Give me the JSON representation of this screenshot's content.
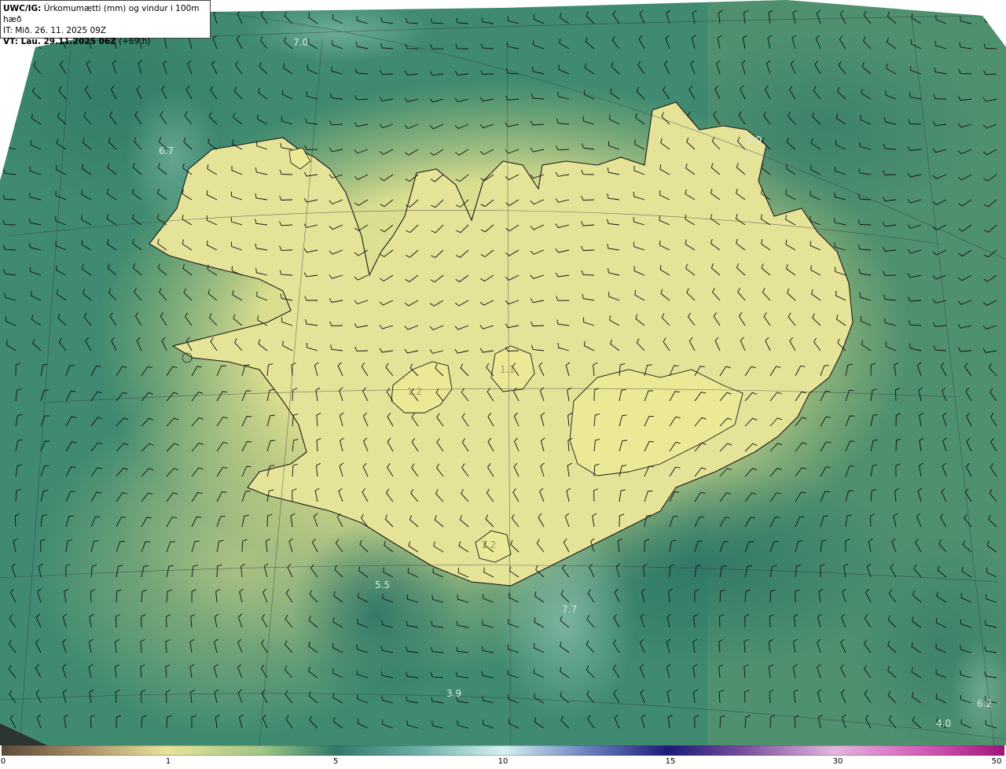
{
  "header": {
    "line1_bold": "UWC/IG:",
    "line1_rest": " Úrkomumætti (mm) og vindur i 100m hæð",
    "line2": "IT: Mið. 26. 11. 2025 09Z",
    "line3_bold": "VT: Lau. 29.11.2025 06Z",
    "line3_rest": " (+69 h)"
  },
  "value_labels": [
    {
      "text": "7.0"
    },
    {
      "text": "6.7"
    },
    {
      "text": "5.0"
    },
    {
      "text": "1.1"
    },
    {
      "text": "1.2"
    },
    {
      "text": "5.5"
    },
    {
      "text": "7.7"
    },
    {
      "text": "3.9"
    },
    {
      "text": "6.2"
    },
    {
      "text": "4.0"
    },
    {
      "text": "1.2"
    }
  ],
  "colorbar": {
    "ticks": [
      "0",
      "1",
      "5",
      "10",
      "15",
      "30",
      "50"
    ]
  },
  "colors": {
    "sea_dark": "#2f7a6a",
    "sea_mid": "#4d9274",
    "land_light": "#e7e598",
    "land_mid": "#c8d283",
    "coast_line": "#1a1a1a"
  }
}
